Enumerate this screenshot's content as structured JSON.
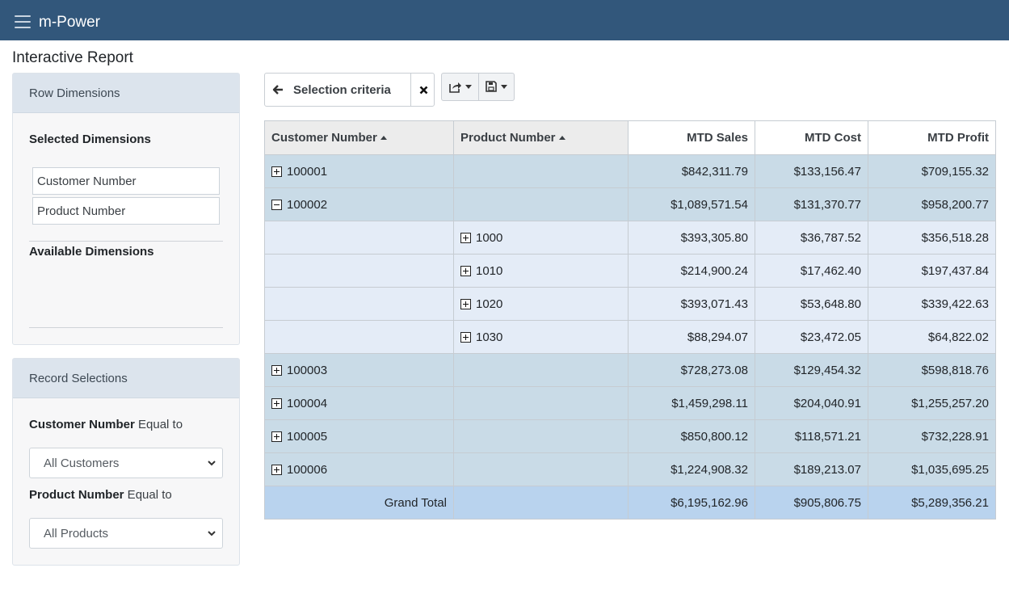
{
  "app": {
    "brand": "m-Power",
    "page_title": "Interactive Report"
  },
  "row_dimensions": {
    "header": "Row Dimensions",
    "selected_title": "Selected Dimensions",
    "selected": [
      "Customer Number",
      "Product Number"
    ],
    "available_title": "Available Dimensions"
  },
  "record_selections": {
    "header": "Record Selections",
    "customer": {
      "field": "Customer Number",
      "op": " Equal to",
      "value": "All Customers"
    },
    "product": {
      "field": "Product Number",
      "op": " Equal to",
      "value": "All Products"
    }
  },
  "toolbar": {
    "selection_label": "Selection criteria",
    "icons": [
      "arrow-left-icon",
      "close-icon",
      "share-icon",
      "save-icon"
    ]
  },
  "table": {
    "headers": [
      "Customer Number",
      "Product Number",
      "MTD Sales",
      "MTD Cost",
      "MTD Profit"
    ],
    "rows": [
      {
        "customer": "100001",
        "product": "",
        "sales": "$842,311.79",
        "cost": "$133,156.47",
        "profit": "$709,155.32"
      },
      {
        "customer": "100002",
        "product": "",
        "sales": "$1,089,571.54",
        "cost": "$131,370.77",
        "profit": "$958,200.77"
      },
      {
        "customer": "",
        "product": "1000",
        "sales": "$393,305.80",
        "cost": "$36,787.52",
        "profit": "$356,518.28"
      },
      {
        "customer": "",
        "product": "1010",
        "sales": "$214,900.24",
        "cost": "$17,462.40",
        "profit": "$197,437.84"
      },
      {
        "customer": "",
        "product": "1020",
        "sales": "$393,071.43",
        "cost": "$53,648.80",
        "profit": "$339,422.63"
      },
      {
        "customer": "",
        "product": "1030",
        "sales": "$88,294.07",
        "cost": "$23,472.05",
        "profit": "$64,822.02"
      },
      {
        "customer": "100003",
        "product": "",
        "sales": "$728,273.08",
        "cost": "$129,454.32",
        "profit": "$598,818.76"
      },
      {
        "customer": "100004",
        "product": "",
        "sales": "$1,459,298.11",
        "cost": "$204,040.91",
        "profit": "$1,255,257.20"
      },
      {
        "customer": "100005",
        "product": "",
        "sales": "$850,800.12",
        "cost": "$118,571.21",
        "profit": "$732,228.91"
      },
      {
        "customer": "100006",
        "product": "",
        "sales": "$1,224,908.32",
        "cost": "$189,213.07",
        "profit": "$1,035,695.25"
      }
    ],
    "total": {
      "label": "Grand Total",
      "sales": "$6,195,162.96",
      "cost": "$905,806.75",
      "profit": "$5,289,356.21"
    }
  },
  "colors": {
    "topbar": "#32577b",
    "panel_head": "#dce4ed",
    "level1_row": "#c9dbe7",
    "level2_row": "#e4ecf7",
    "total_row": "#b9d3ee"
  }
}
